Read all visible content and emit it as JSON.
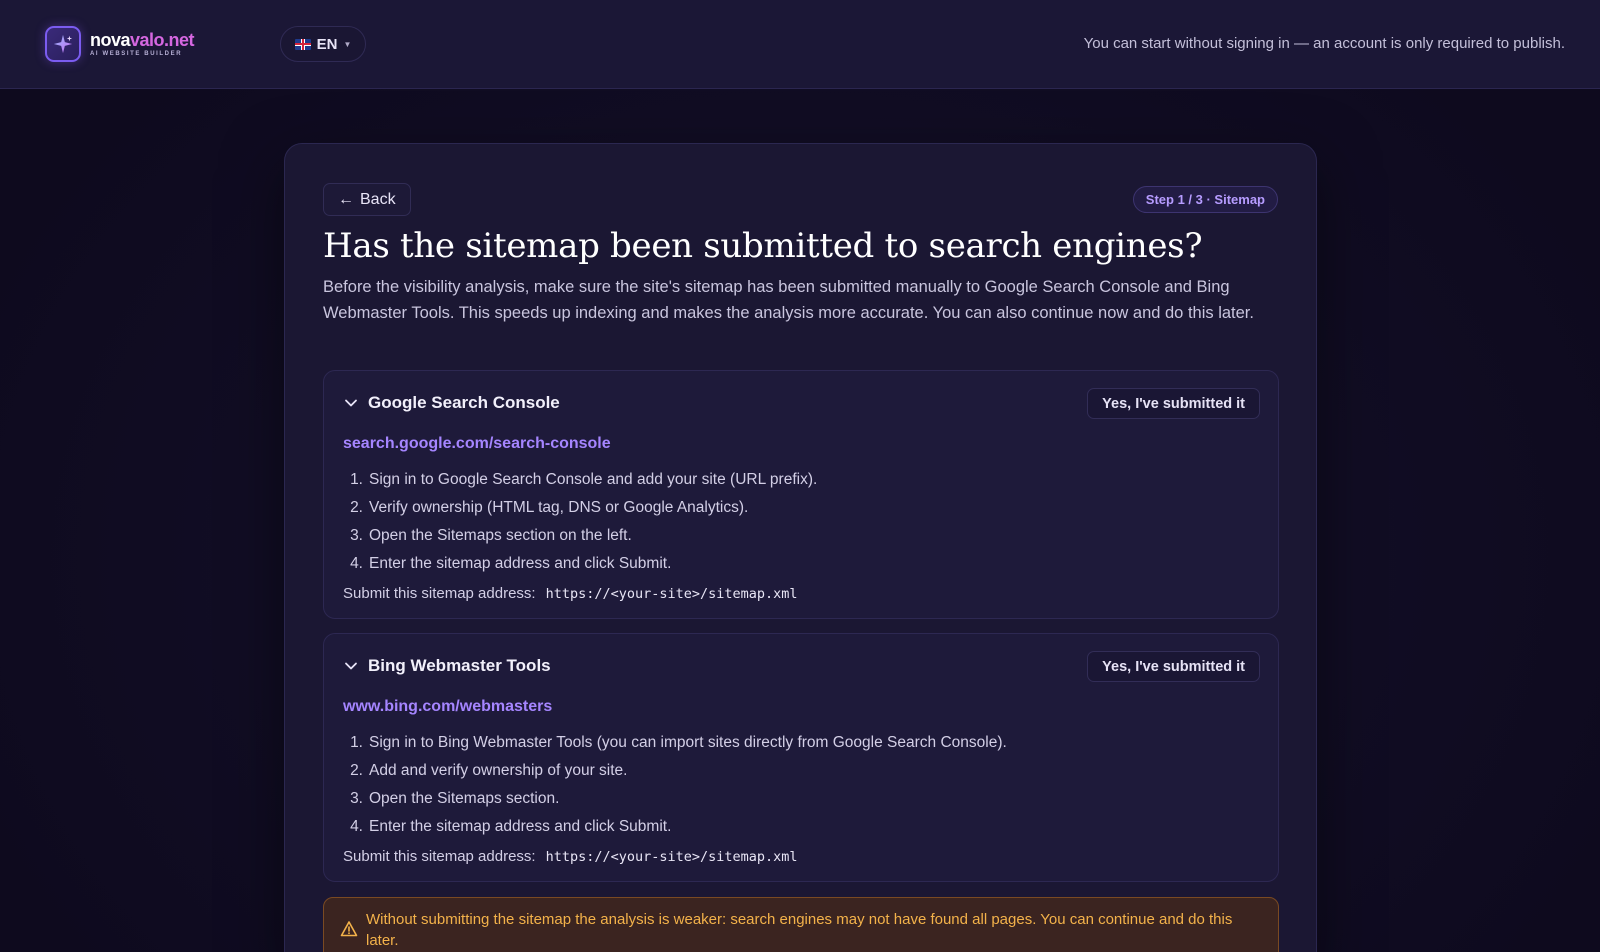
{
  "header": {
    "logo_primary": "nova",
    "logo_secondary": "valo.net",
    "logo_tagline": "AI WEBSITE BUILDER",
    "language": "EN",
    "note": "You can start without signing in — an account is only required to publish."
  },
  "card": {
    "back_label": "Back",
    "back_arrow": "←",
    "step_badge": "Step 1 / 3 · Sitemap",
    "title": "Has the sitemap been submitted to search engines?",
    "intro": "Before the visibility analysis, make sure the site's sitemap has been submitted manually to Google Search Console and Bing Webmaster Tools. This speeds up indexing and makes the analysis more accurate. You can also continue now and do this later."
  },
  "panels": [
    {
      "title": "Google Search Console",
      "button": "Yes, I've submitted it",
      "link": "search.google.com/search-console",
      "steps": [
        {
          "n": "1.",
          "text": "Sign in to Google Search Console and add your site (URL prefix)."
        },
        {
          "n": "2.",
          "text": "Verify ownership (HTML tag, DNS or Google Analytics)."
        },
        {
          "n": "3.",
          "text": "Open the Sitemaps section on the left."
        },
        {
          "n": "4.",
          "text": "Enter the sitemap address and click Submit."
        }
      ],
      "address_label": "Submit this sitemap address:",
      "address": "https://<your-site>/sitemap.xml"
    },
    {
      "title": "Bing Webmaster Tools",
      "button": "Yes, I've submitted it",
      "link": "www.bing.com/webmasters",
      "steps": [
        {
          "n": "1.",
          "text": "Sign in to Bing Webmaster Tools (you can import sites directly from Google Search Console)."
        },
        {
          "n": "2.",
          "text": "Add and verify ownership of your site."
        },
        {
          "n": "3.",
          "text": "Open the Sitemaps section."
        },
        {
          "n": "4.",
          "text": "Enter the sitemap address and click Submit."
        }
      ],
      "address_label": "Submit this sitemap address:",
      "address": "https://<your-site>/sitemap.xml"
    }
  ],
  "warning": {
    "icon": "warning-triangle-icon",
    "text": "Without submitting the sitemap the analysis is weaker: search engines may not have found all pages. You can continue and do this later."
  },
  "colors": {
    "accent": "#a585ff",
    "brand_pink": "#d567e0",
    "warning": "#f3b24a"
  }
}
